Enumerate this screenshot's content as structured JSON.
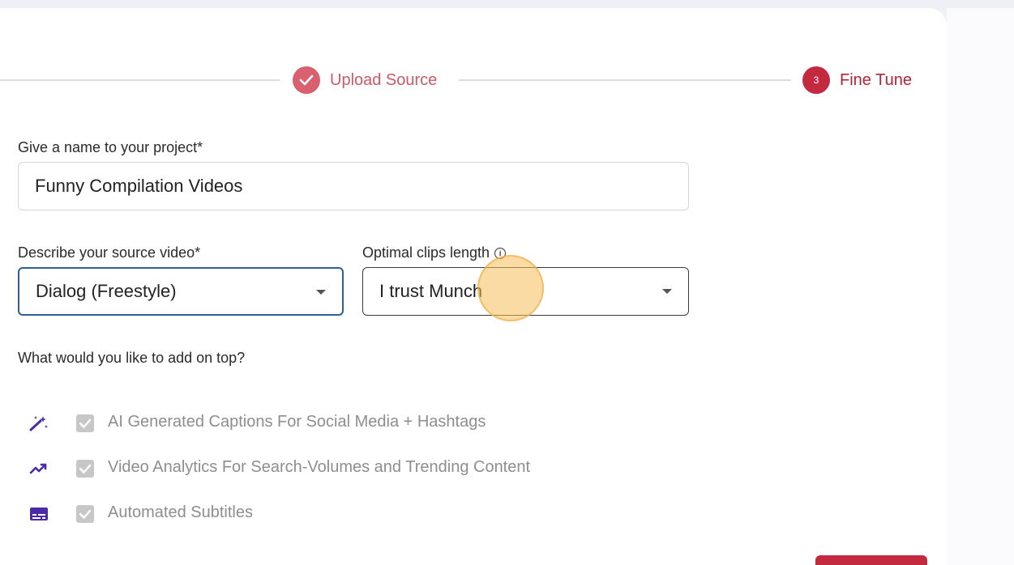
{
  "stepper": {
    "step1_label": "Upload Source",
    "step3_number": "3",
    "step3_label": "Fine Tune"
  },
  "form": {
    "name_label": "Give a name to your project*",
    "name_value": "Funny Compilation Videos",
    "source_label": "Describe your source video*",
    "source_value": "Dialog (Freestyle)",
    "clips_label": "Optimal clips length",
    "clips_value": "I trust Munch",
    "addons_label": "What would you like to add on top?"
  },
  "addons": [
    {
      "icon": "magic-wand-icon",
      "label": "AI Generated Captions For Social Media + Hashtags",
      "checked": true
    },
    {
      "icon": "trending-up-icon",
      "label": "Video Analytics For Search-Volumes and Trending Content",
      "checked": true
    },
    {
      "icon": "subtitles-icon",
      "label": "Automated Subtitles",
      "checked": true
    }
  ],
  "colors": {
    "accent": "#c32a40",
    "accent_light": "#d8606f",
    "icon_purple": "#4b2aa8"
  }
}
